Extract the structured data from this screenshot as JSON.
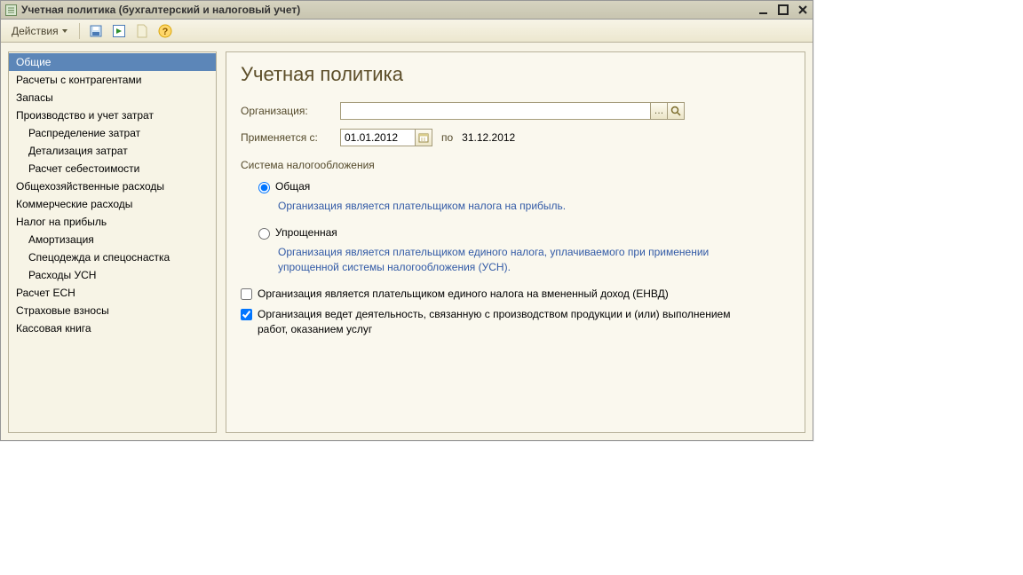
{
  "window": {
    "title": "Учетная политика (бухгалтерский и налоговый учет)"
  },
  "toolbar": {
    "actions_label": "Действия"
  },
  "sidebar": {
    "items": [
      {
        "label": "Общие",
        "selected": true
      },
      {
        "label": "Расчеты с контрагентами"
      },
      {
        "label": "Запасы"
      },
      {
        "label": "Производство и учет затрат"
      },
      {
        "label": "Распределение затрат",
        "child": true
      },
      {
        "label": "Детализация затрат",
        "child": true
      },
      {
        "label": "Расчет себестоимости",
        "child": true
      },
      {
        "label": "Общехозяйственные расходы"
      },
      {
        "label": "Коммерческие расходы"
      },
      {
        "label": "Налог на прибыль"
      },
      {
        "label": "Амортизация",
        "child": true
      },
      {
        "label": "Спецодежда и спецоснастка",
        "child": true
      },
      {
        "label": "Расходы УСН",
        "child": true
      },
      {
        "label": "Расчет ЕСН"
      },
      {
        "label": "Страховые взносы"
      },
      {
        "label": "Кассовая книга"
      }
    ]
  },
  "content": {
    "heading": "Учетная политика",
    "org_label": "Организация:",
    "org_value": "",
    "applies_label": "Применяется с:",
    "date_from": "01.01.2012",
    "po": "по",
    "date_to": "31.12.2012",
    "tax_system_label": "Система налогообложения",
    "radio_general": "Общая",
    "hint_general": "Организация является плательщиком налога на прибыль.",
    "radio_simplified": "Упрощенная",
    "hint_simplified": "Организация является плательщиком единого налога, уплачиваемого при применении упрощенной системы налогообложения (УСН).",
    "check_envd": "Организация является плательщиком единого налога на вмененный доход (ЕНВД)",
    "check_production": "Организация ведет деятельность, связанную с производством продукции и (или) выполнением работ, оказанием услуг"
  }
}
